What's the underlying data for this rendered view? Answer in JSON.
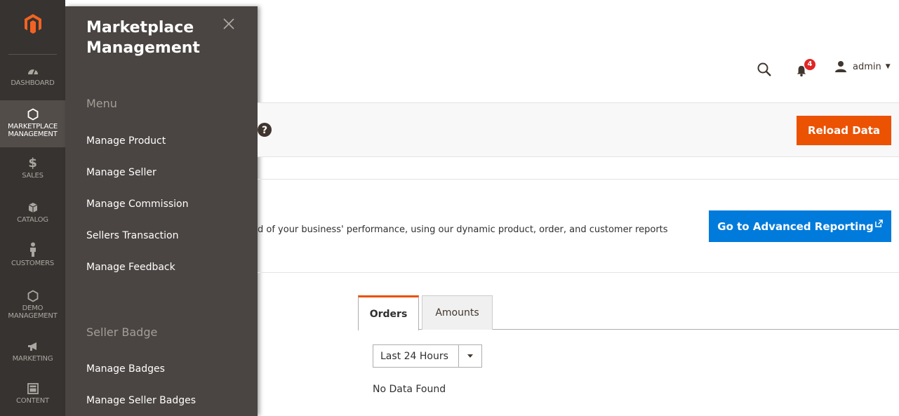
{
  "nav": {
    "items": [
      {
        "label": "DASHBOARD",
        "icon": "dashboard-icon"
      },
      {
        "label": "MARKETPLACE MANAGEMENT",
        "icon": "hexagon-icon"
      },
      {
        "label": "SALES",
        "icon": "dollar-icon"
      },
      {
        "label": "CATALOG",
        "icon": "box-icon"
      },
      {
        "label": "CUSTOMERS",
        "icon": "person-icon"
      },
      {
        "label": "DEMO MANAGEMENT",
        "icon": "hexagon-icon"
      },
      {
        "label": "MARKETING",
        "icon": "megaphone-icon"
      },
      {
        "label": "CONTENT",
        "icon": "layout-icon"
      }
    ]
  },
  "panel": {
    "title": "Marketplace Management",
    "section_menu": "Menu",
    "menu_links": [
      "Manage Product",
      "Manage Seller",
      "Manage Commission",
      "Sellers Transaction",
      "Manage Feedback"
    ],
    "section_badge": "Seller Badge",
    "badge_links": [
      "Manage Badges",
      "Manage Seller Badges"
    ]
  },
  "header": {
    "notification_count": "4",
    "user_name": "admin"
  },
  "page_actions": {
    "reload_label": "Reload Data"
  },
  "reporting": {
    "text": "d of your business' performance, using our dynamic product, order, and customer reports",
    "button_label": "Go to Advanced Reporting"
  },
  "tabs": {
    "orders": "Orders",
    "amounts": "Amounts"
  },
  "period": {
    "selected": "Last 24 Hours"
  },
  "no_data": "No Data Found",
  "colors": {
    "nav_bg": "#373330",
    "panel_bg": "#4a4542",
    "accent_orange": "#eb5202",
    "accent_blue": "#007bdb",
    "badge_red": "#e22626"
  }
}
